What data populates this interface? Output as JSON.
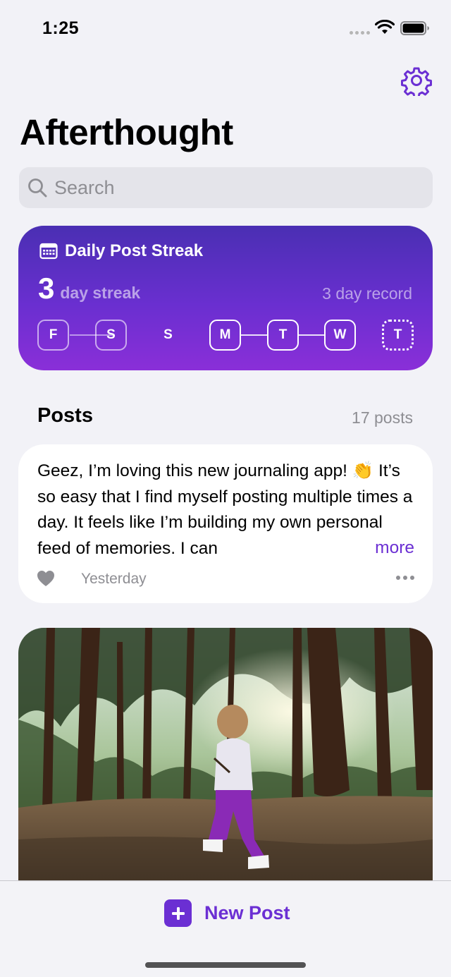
{
  "status_bar": {
    "time": "1:25"
  },
  "header": {
    "title": "Afterthought",
    "settings_icon": "gear-icon"
  },
  "search": {
    "placeholder": "Search",
    "value": ""
  },
  "streak": {
    "title": "Daily Post Streak",
    "count": "3",
    "unit": "day streak",
    "record": "3 day record",
    "days": [
      {
        "label": "F",
        "posted": true
      },
      {
        "label": "S",
        "posted": true
      },
      {
        "label": "S",
        "posted": false
      },
      {
        "label": "M",
        "posted": true
      },
      {
        "label": "T",
        "posted": true
      },
      {
        "label": "W",
        "posted": true
      },
      {
        "label": "T",
        "posted": false,
        "today": true
      }
    ],
    "colors": {
      "gradient_top": "#4a2fb3",
      "gradient_bottom": "#8a2fd8"
    }
  },
  "posts": {
    "heading": "Posts",
    "count": "17 posts",
    "items": [
      {
        "text": "Geez, I’m loving this new journaling app! 👏 It’s so easy that I find myself posting multiple times a day. It feels like I’m building my own personal feed of memories. I can",
        "more": "more",
        "date": "Yesterday",
        "liked": false
      }
    ]
  },
  "bottom_bar": {
    "new_post_label": "New Post",
    "accent": "#6b2fd3"
  }
}
